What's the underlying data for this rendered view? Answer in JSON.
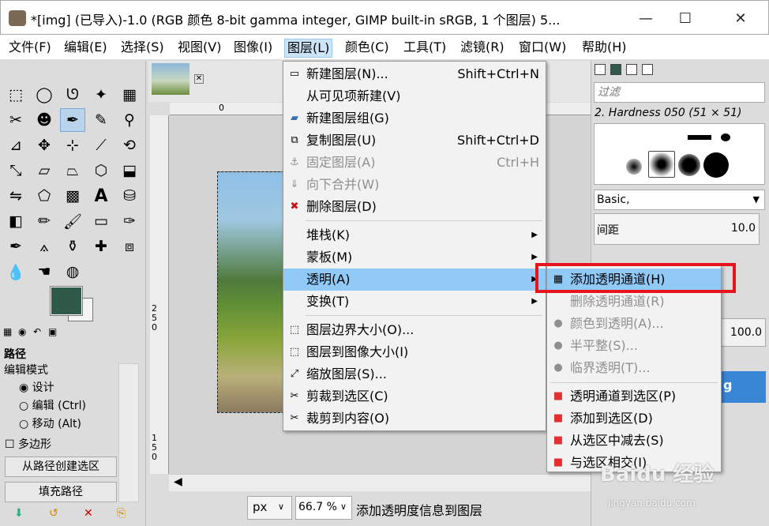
{
  "window": {
    "title": "*[img] (已导入)-1.0 (RGB 颜色 8-bit gamma integer, GIMP built-in sRGB, 1 个图层) 5...",
    "minimize": "—",
    "maximize": "☐",
    "close": "✕"
  },
  "menubar": [
    "文件(F)",
    "编辑(E)",
    "选择(S)",
    "视图(V)",
    "图像(I)",
    "图层(L)",
    "颜色(C)",
    "工具(T)",
    "滤镜(R)",
    "窗口(W)",
    "帮助(H)"
  ],
  "layer_menu": [
    {
      "label": "新建图层(N)...",
      "shortcut": "Shift+Ctrl+N",
      "icon": "▭",
      "disabled": false
    },
    {
      "label": "从可见项新建(V)",
      "shortcut": "",
      "icon": "",
      "disabled": false
    },
    {
      "label": "新建图层组(G)",
      "shortcut": "",
      "icon": "▰",
      "disabled": false
    },
    {
      "label": "复制图层(U)",
      "shortcut": "Shift+Ctrl+D",
      "icon": "⧉",
      "disabled": false
    },
    {
      "label": "固定图层(A)",
      "shortcut": "Ctrl+H",
      "icon": "⚓",
      "disabled": true
    },
    {
      "label": "向下合并(W)",
      "shortcut": "",
      "icon": "⇓",
      "disabled": true
    },
    {
      "label": "删除图层(D)",
      "shortcut": "",
      "icon": "✖",
      "disabled": false
    },
    {
      "label": "堆栈(K)",
      "shortcut": "",
      "icon": "",
      "disabled": false,
      "submenu": true
    },
    {
      "label": "蒙板(M)",
      "shortcut": "",
      "icon": "",
      "disabled": false,
      "submenu": true
    },
    {
      "label": "透明(A)",
      "shortcut": "",
      "icon": "",
      "disabled": false,
      "submenu": true,
      "highlight": true
    },
    {
      "label": "变换(T)",
      "shortcut": "",
      "icon": "",
      "disabled": false,
      "submenu": true
    },
    {
      "label": "图层边界大小(O)...",
      "shortcut": "",
      "icon": "⬚",
      "disabled": false
    },
    {
      "label": "图层到图像大小(I)",
      "shortcut": "",
      "icon": "⬚",
      "disabled": false
    },
    {
      "label": "缩放图层(S)...",
      "shortcut": "",
      "icon": "⤢",
      "disabled": false
    },
    {
      "label": "剪裁到选区(C)",
      "shortcut": "",
      "icon": "✂",
      "disabled": false
    },
    {
      "label": "裁剪到内容(O)",
      "shortcut": "",
      "icon": "✂",
      "disabled": false
    }
  ],
  "transparency_submenu": [
    {
      "label": "添加透明通道(H)",
      "icon": "▦",
      "disabled": false,
      "highlight": true
    },
    {
      "label": "删除透明通道(R)",
      "icon": "",
      "disabled": true
    },
    {
      "label": "颜色到透明(A)...",
      "icon": "●",
      "disabled": true
    },
    {
      "label": "半平整(S)...",
      "icon": "●",
      "disabled": true
    },
    {
      "label": "临界透明(T)...",
      "icon": "●",
      "disabled": true
    },
    {
      "label": "透明通道到选区(P)",
      "icon": "■",
      "disabled": false
    },
    {
      "label": "添加到选区(D)",
      "icon": "■",
      "disabled": false
    },
    {
      "label": "从选区中减去(S)",
      "icon": "■",
      "disabled": false
    },
    {
      "label": "与选区相交(I)",
      "icon": "■",
      "disabled": false
    }
  ],
  "paths_panel": {
    "title": "路径",
    "edit_mode": "编辑模式",
    "modes": [
      "设计",
      "编辑 (Ctrl)",
      "移动 (Alt)"
    ],
    "polygon": "多边形",
    "create_selection": "从路径创建选区",
    "fill_path": "填充路径"
  },
  "ruler": {
    "top_zero": "0",
    "left_marks": [
      "2",
      "5",
      "0",
      "1",
      "5",
      "0"
    ]
  },
  "statusbar": {
    "unit": "px",
    "zoom": "66.7 %",
    "message": "添加透明度信息到图层"
  },
  "dock": {
    "filter_placeholder": "过滤",
    "brush_name": "2. Hardness 050 (51 × 51)",
    "preset": "Basic,",
    "spacing_label": "间距",
    "spacing_value": "10.0",
    "opacity_value": "100.0",
    "layer_text": "g"
  },
  "watermark": {
    "brand": "Baidu 经验",
    "site": "jingyan.baidu.com"
  },
  "colors": {
    "accent_highlight": "#91c9f7",
    "red_box": "#e8141c",
    "fg_color": "#2f5a4a"
  }
}
